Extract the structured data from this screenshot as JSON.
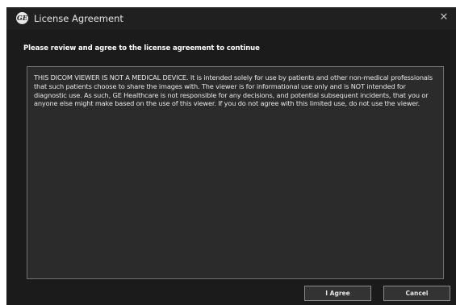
{
  "window": {
    "title": "License Agreement",
    "logo_text": "GE",
    "close_glyph": "✕"
  },
  "instruction": "Please review and agree to the license agreement to continue",
  "license_text": "THIS DICOM VIEWER IS NOT A MEDICAL DEVICE. It is intended solely for use by patients and other non-medical professionals that such patients choose to share the images with. The viewer is for informational use only and is NOT intended for diagnostic use. As such, GE Healthcare is not responsible for any decisions, and potential subsequent incidents, that you or anyone else might make based on the use of this viewer. If you do not agree with this limited use, do not use the viewer.",
  "buttons": {
    "agree": "I Agree",
    "cancel": "Cancel"
  },
  "colors": {
    "window_bg": "#1b1b1b",
    "text_area_bg": "#2b2b2b",
    "text": "#e8e8e8"
  }
}
